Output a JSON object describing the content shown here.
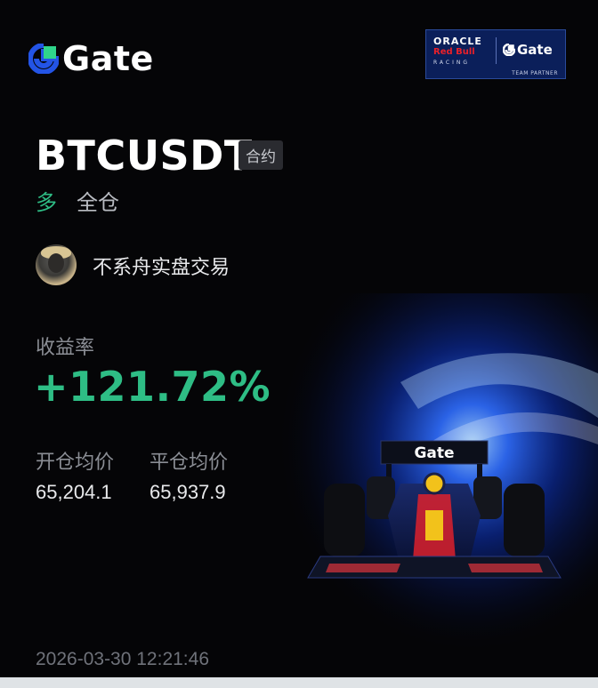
{
  "brand": {
    "name": "Gate"
  },
  "partner": {
    "line1": "ORACLE",
    "line2": "Red Bull",
    "line3": "RACING",
    "brand": "Gate",
    "caption": "TEAM PARTNER"
  },
  "position": {
    "pair": "BTCUSDT",
    "type_tag": "合约",
    "side": "多",
    "margin_mode": "全仓"
  },
  "user": {
    "name": "不系舟实盘交易"
  },
  "stats": {
    "roi_label": "收益率",
    "roi_value": "+121.72%",
    "entry_label": "开仓均价",
    "entry_value": "65,204.1",
    "close_label": "平仓均价",
    "close_value": "65,937.9"
  },
  "timestamp": "2026-03-30 12:21:46",
  "car_wing_text": "Gate",
  "colors": {
    "profit": "#2ebd85",
    "brand_blue": "#2354e6",
    "background": "#050507"
  }
}
